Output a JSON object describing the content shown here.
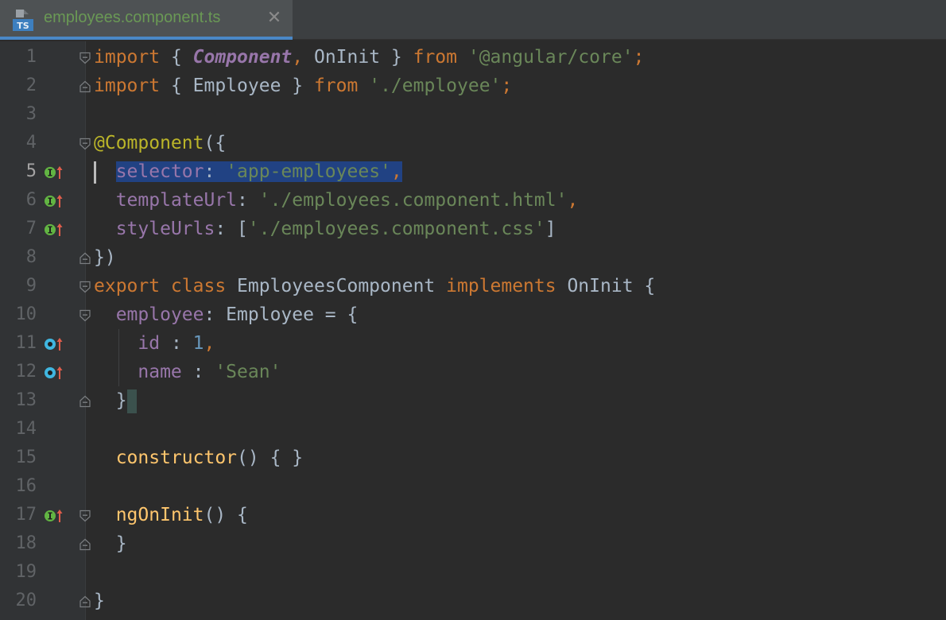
{
  "tab": {
    "file_type_badge": "TS",
    "title": "employees.component.ts",
    "close_glyph": "✕"
  },
  "lines": [
    {
      "n": "1",
      "tokens": [
        [
          "kw",
          "import"
        ],
        [
          "plain",
          " { "
        ],
        [
          "comp",
          "Component"
        ],
        [
          "kw",
          ","
        ],
        [
          "plain",
          " OnInit } "
        ],
        [
          "kw",
          "from"
        ],
        [
          "plain",
          " "
        ],
        [
          "str",
          "'@angular/core'"
        ],
        [
          "kw",
          ";"
        ]
      ],
      "fold": "open",
      "gutter_icon": ""
    },
    {
      "n": "2",
      "tokens": [
        [
          "kw",
          "import"
        ],
        [
          "plain",
          " { Employee } "
        ],
        [
          "kw",
          "from"
        ],
        [
          "plain",
          " "
        ],
        [
          "str",
          "'./employee'"
        ],
        [
          "kw",
          ";"
        ]
      ],
      "fold": "close",
      "gutter_icon": ""
    },
    {
      "n": "3",
      "tokens": [],
      "fold": "",
      "gutter_icon": ""
    },
    {
      "n": "4",
      "tokens": [
        [
          "ann",
          "@Component"
        ],
        [
          "plain",
          "({"
        ]
      ],
      "fold": "open",
      "gutter_icon": ""
    },
    {
      "n": "5",
      "tokens": [
        [
          "plain",
          "  "
        ],
        [
          "prop",
          "selector"
        ],
        [
          "plain",
          ": "
        ],
        [
          "str",
          "'app-employees'"
        ],
        [
          "kw",
          ","
        ]
      ],
      "fold": "",
      "gutter_icon": "implements",
      "current": true,
      "selected": true
    },
    {
      "n": "6",
      "tokens": [
        [
          "plain",
          "  "
        ],
        [
          "prop",
          "templateUrl"
        ],
        [
          "plain",
          ": "
        ],
        [
          "str",
          "'./employees.component.html'"
        ],
        [
          "kw",
          ","
        ]
      ],
      "fold": "",
      "gutter_icon": "implements"
    },
    {
      "n": "7",
      "tokens": [
        [
          "plain",
          "  "
        ],
        [
          "prop",
          "styleUrls"
        ],
        [
          "plain",
          ": ["
        ],
        [
          "str",
          "'./employees.component.css'"
        ],
        [
          "plain",
          "]"
        ]
      ],
      "fold": "",
      "gutter_icon": "implements"
    },
    {
      "n": "8",
      "tokens": [
        [
          "plain",
          "})"
        ]
      ],
      "fold": "close",
      "gutter_icon": ""
    },
    {
      "n": "9",
      "tokens": [
        [
          "kw",
          "export class"
        ],
        [
          "plain",
          " EmployeesComponent "
        ],
        [
          "kw",
          "implements"
        ],
        [
          "plain",
          " OnInit {"
        ]
      ],
      "fold": "open",
      "gutter_icon": ""
    },
    {
      "n": "10",
      "tokens": [
        [
          "plain",
          "  "
        ],
        [
          "prop",
          "employee"
        ],
        [
          "plain",
          ": Employee = {"
        ]
      ],
      "fold": "open",
      "gutter_icon": ""
    },
    {
      "n": "11",
      "tokens": [
        [
          "plain",
          "    "
        ],
        [
          "prop",
          "id"
        ],
        [
          "plain",
          " : "
        ],
        [
          "num",
          "1"
        ],
        [
          "kw",
          ","
        ]
      ],
      "fold": "",
      "gutter_icon": "overrides"
    },
    {
      "n": "12",
      "tokens": [
        [
          "plain",
          "    "
        ],
        [
          "prop",
          "name"
        ],
        [
          "plain",
          " : "
        ],
        [
          "str",
          "'Sean'"
        ]
      ],
      "fold": "",
      "gutter_icon": "overrides"
    },
    {
      "n": "13",
      "tokens": [
        [
          "plain",
          "  }"
        ]
      ],
      "fold": "close",
      "gutter_icon": "",
      "brace_highlight": true
    },
    {
      "n": "14",
      "tokens": [],
      "fold": "",
      "gutter_icon": ""
    },
    {
      "n": "15",
      "tokens": [
        [
          "plain",
          "  "
        ],
        [
          "fn",
          "constructor"
        ],
        [
          "plain",
          "() { }"
        ]
      ],
      "fold": "",
      "gutter_icon": ""
    },
    {
      "n": "16",
      "tokens": [],
      "fold": "",
      "gutter_icon": ""
    },
    {
      "n": "17",
      "tokens": [
        [
          "plain",
          "  "
        ],
        [
          "fn",
          "ngOnInit"
        ],
        [
          "plain",
          "() {"
        ]
      ],
      "fold": "open",
      "gutter_icon": "implements"
    },
    {
      "n": "18",
      "tokens": [
        [
          "plain",
          "  }"
        ]
      ],
      "fold": "close",
      "gutter_icon": ""
    },
    {
      "n": "19",
      "tokens": [],
      "fold": "",
      "gutter_icon": ""
    },
    {
      "n": "20",
      "tokens": [
        [
          "plain",
          "}"
        ]
      ],
      "fold": "close",
      "gutter_icon": ""
    }
  ],
  "colors": {
    "background": "#2b2b2b",
    "gutter": "#313335",
    "keyword": "#cc7832",
    "string": "#6a8759",
    "number": "#6897bb",
    "property": "#9876aa",
    "annotation": "#bbb529",
    "function": "#ffc66d",
    "selection": "#214283",
    "implements_marker": "#62b543",
    "overrides_marker": "#40b6e0",
    "arrow_marker": "#e05d4b"
  }
}
